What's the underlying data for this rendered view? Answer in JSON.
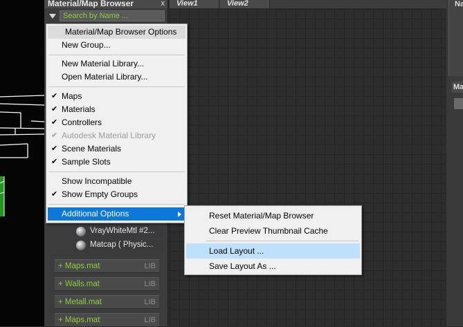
{
  "browser": {
    "title": "Material/Map Browser",
    "close_glyph": "x",
    "search_placeholder": "Search by Name ..."
  },
  "materials": [
    {
      "label": "VrayWhiteMtl #2...",
      "icon": "material-sphere-icon"
    },
    {
      "label": "Matcap  ( Physic...",
      "icon": "material-sphere-icon"
    }
  ],
  "libraries": [
    {
      "name": "+ Maps.mat",
      "tag": "LIB"
    },
    {
      "name": "+ Walls.mat",
      "tag": "LIB"
    },
    {
      "name": "+ Metall.mat",
      "tag": "LIB"
    },
    {
      "name": "+ Maps.mat",
      "tag": "LIB"
    }
  ],
  "viewports": {
    "tabs": [
      "View1",
      "View2"
    ]
  },
  "right_panel": {
    "top_label": "Na",
    "title": "Ma"
  },
  "menu": {
    "header": "Material/Map Browser Options",
    "items": [
      {
        "label": "New Group...",
        "checked": false,
        "disabled": false
      },
      {
        "label": "New Material Library...",
        "checked": false,
        "disabled": false
      },
      {
        "label": "Open Material Library...",
        "checked": false,
        "disabled": false
      },
      {
        "label": "Maps",
        "checked": true,
        "disabled": false
      },
      {
        "label": "Materials",
        "checked": true,
        "disabled": false
      },
      {
        "label": "Controllers",
        "checked": true,
        "disabled": false
      },
      {
        "label": "Autodesk Material Library",
        "checked": true,
        "disabled": true
      },
      {
        "label": "Scene Materials",
        "checked": true,
        "disabled": false
      },
      {
        "label": "Sample Slots",
        "checked": true,
        "disabled": false
      },
      {
        "label": "Show Incompatible",
        "checked": false,
        "disabled": false
      },
      {
        "label": "Show Empty Groups",
        "checked": true,
        "disabled": false
      },
      {
        "label": "Additional Options",
        "checked": false,
        "disabled": false,
        "has_submenu": true
      }
    ],
    "check_glyph": "✔"
  },
  "submenu": {
    "items": [
      {
        "label": "Reset Material/Map Browser"
      },
      {
        "label": "Clear Preview Thumbnail Cache"
      },
      {
        "label": "Load Layout ..."
      },
      {
        "label": "Save Layout As ..."
      }
    ]
  },
  "colors": {
    "accent_green": "#8ccf3c",
    "menu_highlight": "#0c79d8",
    "submenu_hover": "#bfe0fb"
  }
}
